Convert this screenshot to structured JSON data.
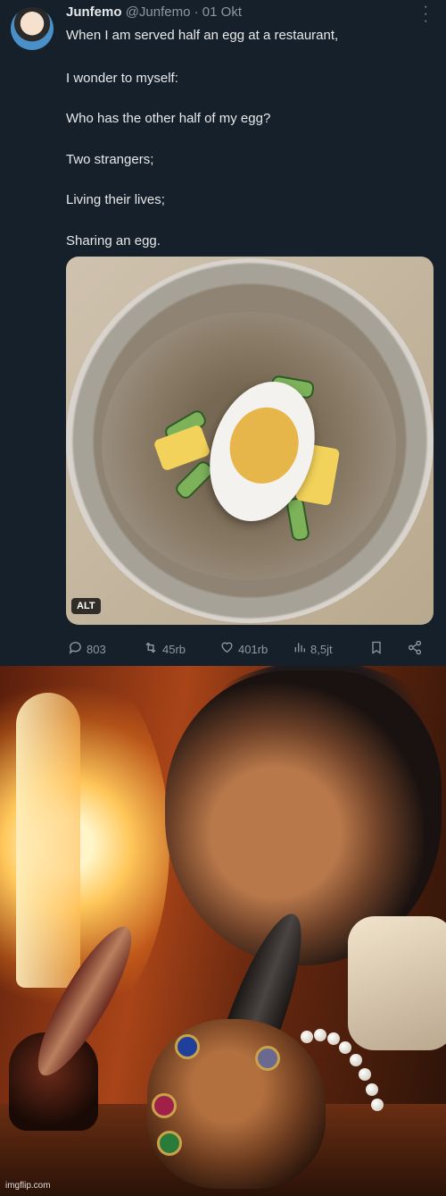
{
  "tweet": {
    "display_name": "Junfemo",
    "handle": "@Junfemo",
    "separator": "·",
    "date": "01 Okt",
    "lines": [
      "When I am served half an egg at a restaurant,",
      "I wonder to myself:",
      "Who has the other half of my egg?",
      "Two strangers;",
      "Living their lives;",
      "Sharing an egg."
    ],
    "alt_badge": "ALT",
    "actions": {
      "replies": "803",
      "retweets": "45rb",
      "likes": "401rb",
      "views": "8,5jt"
    },
    "icons": {
      "reply": "reply-icon",
      "retweet": "retweet-icon",
      "like": "heart-icon",
      "views": "views-icon",
      "bookmark": "bookmark-icon",
      "share": "share-icon",
      "more": "more-icon"
    },
    "colors": {
      "background": "#16202a",
      "text": "#e7e9ea",
      "muted": "#8b98a5"
    }
  },
  "painting": {
    "watermark": "imgflip.com"
  }
}
